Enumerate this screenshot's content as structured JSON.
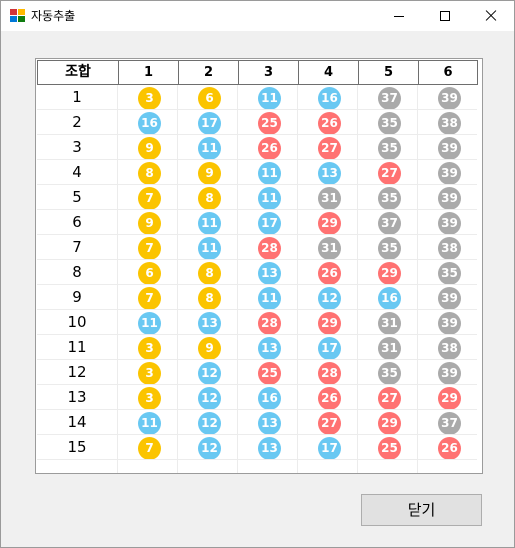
{
  "window": {
    "title": "자동추출"
  },
  "grid": {
    "headers": [
      "조합",
      "1",
      "2",
      "3",
      "4",
      "5",
      "6"
    ],
    "rows": [
      [
        3,
        6,
        11,
        16,
        37,
        39
      ],
      [
        16,
        17,
        25,
        26,
        35,
        38
      ],
      [
        9,
        11,
        26,
        27,
        35,
        39
      ],
      [
        8,
        9,
        11,
        13,
        27,
        39
      ],
      [
        7,
        8,
        11,
        31,
        35,
        39
      ],
      [
        9,
        11,
        17,
        29,
        37,
        39
      ],
      [
        7,
        11,
        28,
        31,
        35,
        38
      ],
      [
        6,
        8,
        13,
        26,
        29,
        35
      ],
      [
        7,
        8,
        11,
        12,
        16,
        39
      ],
      [
        11,
        13,
        28,
        29,
        31,
        39
      ],
      [
        3,
        9,
        13,
        17,
        31,
        38
      ],
      [
        3,
        12,
        25,
        28,
        35,
        39
      ],
      [
        3,
        12,
        16,
        26,
        27,
        29
      ],
      [
        11,
        12,
        13,
        27,
        29,
        37
      ],
      [
        7,
        12,
        13,
        17,
        25,
        26
      ]
    ]
  },
  "ball_colors": {
    "1-10": "#fbc400",
    "11-20": "#69c8f2",
    "21-30": "#ff7272",
    "31-40": "#aaaaaa"
  },
  "buttons": {
    "close_label": "닫기"
  }
}
